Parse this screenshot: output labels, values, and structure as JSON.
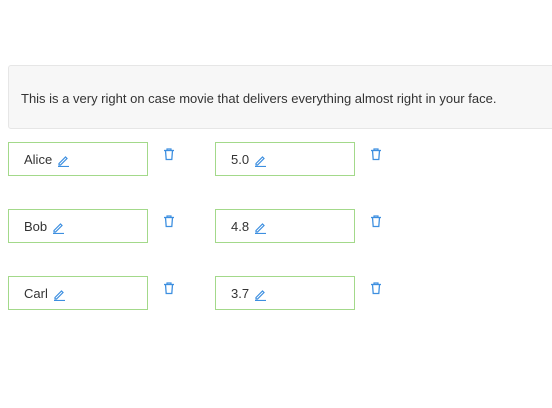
{
  "review": {
    "text": "This is a very right on case movie that delivers everything almost right in your face."
  },
  "rows": [
    {
      "name": "Alice",
      "score": "5.0"
    },
    {
      "name": "Bob",
      "score": "4.8"
    },
    {
      "name": "Carl",
      "score": "3.7"
    }
  ],
  "colors": {
    "accent": "#3d8fe0",
    "cell_border": "#a3d98a"
  },
  "icons": {
    "edit": "pencil-icon",
    "delete": "trash-icon"
  }
}
